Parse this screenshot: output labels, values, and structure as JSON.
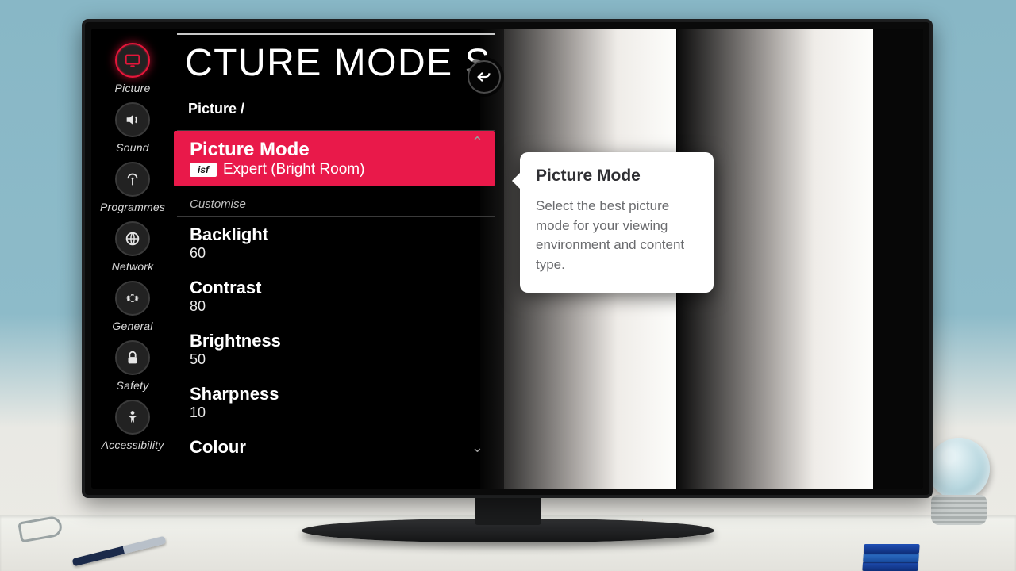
{
  "sidebar": {
    "items": [
      {
        "id": "picture",
        "label": "Picture",
        "icon": "tv-icon",
        "active": true
      },
      {
        "id": "sound",
        "label": "Sound",
        "icon": "speaker-icon",
        "active": false
      },
      {
        "id": "programmes",
        "label": "Programmes",
        "icon": "antenna-icon",
        "active": false
      },
      {
        "id": "network",
        "label": "Network",
        "icon": "globe-icon",
        "active": false
      },
      {
        "id": "general",
        "label": "General",
        "icon": "gear-icon",
        "active": false
      },
      {
        "id": "safety",
        "label": "Safety",
        "icon": "lock-icon",
        "active": false
      },
      {
        "id": "accessibility",
        "label": "Accessibility",
        "icon": "person-icon",
        "active": false
      }
    ]
  },
  "header": {
    "title_visible_fragment": "CTURE MODE SE",
    "breadcrumb": "Picture /"
  },
  "picture_mode_row": {
    "label": "Picture Mode",
    "badge": "isf",
    "value": "Expert (Bright Room)"
  },
  "customise_section_label": "Customise",
  "settings": [
    {
      "name": "Backlight",
      "value": "60"
    },
    {
      "name": "Contrast",
      "value": "80"
    },
    {
      "name": "Brightness",
      "value": "50"
    },
    {
      "name": "Sharpness",
      "value": "10"
    },
    {
      "name": "Colour",
      "value": ""
    }
  ],
  "help_card": {
    "title": "Picture Mode",
    "body": "Select the best picture mode for your viewing environment and content type."
  },
  "colors": {
    "accent": "#e9194a",
    "active_ring": "#e6163a"
  }
}
